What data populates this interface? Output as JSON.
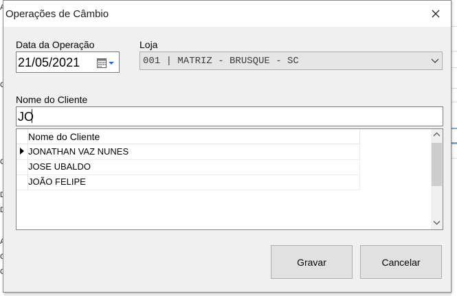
{
  "dialog": {
    "title": "Operações de Câmbio",
    "close_icon": "close-icon"
  },
  "form": {
    "date_label": "Data da Operação",
    "date_value": "21/05/2021",
    "calendar_icon": "calendar-icon",
    "loja_label": "Loja",
    "loja_value": "001 | MATRIZ - BRUSQUE - SC",
    "client_label": "Nome do Cliente",
    "client_value": "JO"
  },
  "grid": {
    "column_header": "Nome do Cliente",
    "rows": [
      "JONATHAN VAZ NUNES",
      "JOSE UBALDO",
      "JOÃO FELIPE"
    ],
    "current_row": 0
  },
  "buttons": {
    "save": "Gravar",
    "cancel": "Cancelar"
  },
  "background": {
    "left_marks": [
      "A",
      "C",
      "C",
      "D",
      "D",
      "A",
      "C",
      "C"
    ]
  },
  "colors": {
    "dialog_bg": "#f0f0f0",
    "button_bg": "#e1e1e1",
    "disabled_field_bg": "#e6e6e6"
  }
}
